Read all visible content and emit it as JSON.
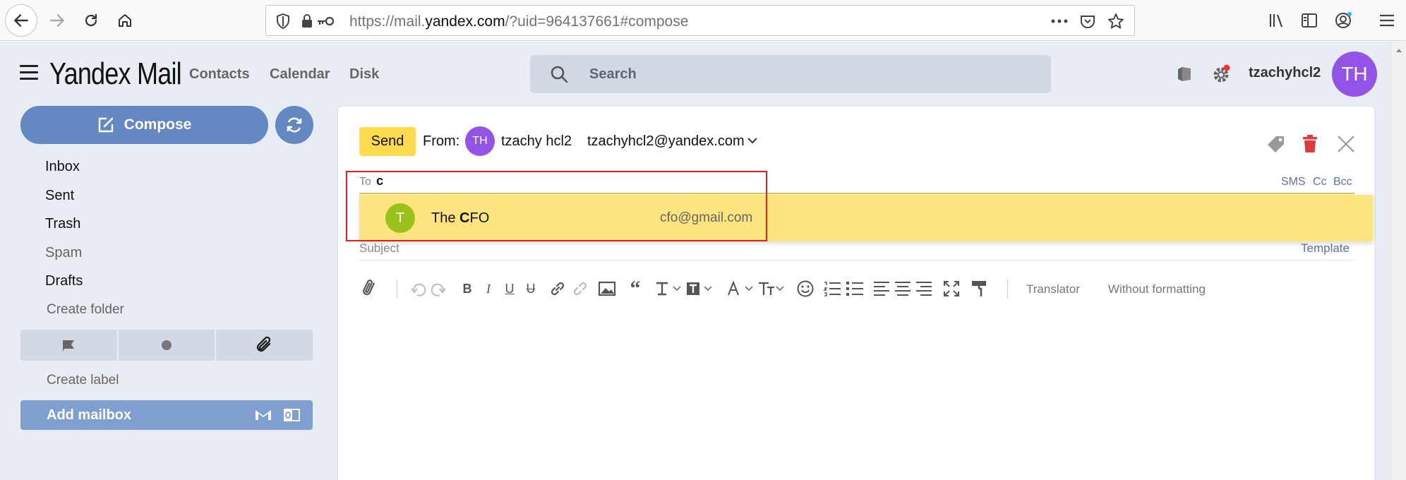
{
  "browser": {
    "url_prefix": "https://mail.",
    "url_domain": "yandex.com",
    "url_suffix": "/?uid=964137661#compose"
  },
  "app": {
    "logo": "Yandex Mail",
    "nav": [
      "Contacts",
      "Calendar",
      "Disk"
    ],
    "search_placeholder": "Search",
    "username": "tzachyhcl2",
    "avatar_initials": "TH"
  },
  "sidebar": {
    "compose_label": "Compose",
    "folders": [
      "Inbox",
      "Sent",
      "Trash",
      "Spam",
      "Drafts"
    ],
    "create_folder": "Create folder",
    "create_label": "Create label",
    "add_mailbox": "Add mailbox"
  },
  "compose": {
    "send_label": "Send",
    "from_label": "From:",
    "from_avatar": "TH",
    "from_name": "tzachy hcl2",
    "from_email": "tzachyhcl2@yandex.com",
    "to_label": "To",
    "to_value": "c",
    "recipient_links": [
      "SMS",
      "Cc",
      "Bcc"
    ],
    "subject_placeholder": "Subject",
    "template_link": "Template",
    "translator_label": "Translator",
    "without_formatting_label": "Without formatting"
  },
  "suggestion": {
    "avatar": "T",
    "name_prefix": "The ",
    "name_match": "C",
    "name_rest": "FO",
    "email": "cfo@gmail.com"
  },
  "colors": {
    "accent_blue": "#6488c2",
    "send_yellow": "#ffdb4d",
    "suggest_yellow": "#fde47f",
    "avatar_purple": "#9253e6",
    "delete_red": "#e0393e",
    "highlight_red": "#e02020"
  }
}
